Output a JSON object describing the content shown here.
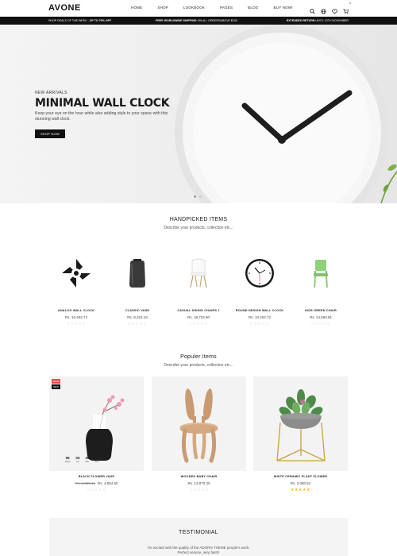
{
  "header": {
    "logo": "AVONE",
    "nav": [
      "HOME",
      "SHOP",
      "LOOKBOOK",
      "PAGES",
      "BLOG",
      "BUY NOW!"
    ],
    "cart_count": "0",
    "icons": [
      "search-icon",
      "globe-icon",
      "heart-icon",
      "cart-icon"
    ]
  },
  "promo": {
    "left_prefix": "SHOP DEALS OF THE WEEK - ",
    "left_bold": "UP TO 70% OFF",
    "center_bold": "FREE WORLDWIDE SHIPPING",
    "center_rest": " ON ALL ORDERSABOVE $100",
    "right_bold": "EXTENDED RETURN",
    "right_rest": " UNTIL 10TH NOVEMBER"
  },
  "hero": {
    "subtitle": "NEW ARRIVALS",
    "title": "MINIMAL WALL CLOCK",
    "description": "Keep your eye on the hour while also adding style to your space with this stunning wall clock.",
    "button": "SHOP NOW"
  },
  "handpicked": {
    "title": "HANDPICKED ITEMS",
    "subtitle": "Describe your products, collection etc...",
    "items": [
      {
        "name": "ANALOG WALL CLOCK",
        "price": "Rs. 10,402.72",
        "stars": "☆☆☆☆☆"
      },
      {
        "name": "CLASSIC VASE",
        "price": "Rs. 8,322.18",
        "stars": "☆☆☆☆☆"
      },
      {
        "name": "CASUAL DINING CHAIRS 1",
        "price": "Rs. 18,724.90",
        "stars": "☆☆☆☆☆"
      },
      {
        "name": "ROUND DESIGN WALL CLOCK",
        "price": "Rs. 10,402.72",
        "stars": "☆☆☆☆☆"
      },
      {
        "name": "KIDS GREEN CHAIR",
        "price": "Rs. 14,563.81",
        "stars": "☆☆☆☆☆"
      }
    ]
  },
  "popular": {
    "title": "Populer Items",
    "subtitle": "Describe your products, collection etc...",
    "items": [
      {
        "name": "BLACK FLOWER VASE",
        "old_price": "Rs. 6,335.15",
        "price": "Rs. 4,854.50",
        "stars": "☆☆☆☆☆",
        "rating": 0,
        "badge_sale": "SALE",
        "badge_new": "NEW"
      },
      {
        "name": "WOODEN BABY CHAIR",
        "price": "Rs. 13,870.30",
        "stars": "☆☆☆☆☆",
        "rating": 0
      },
      {
        "name": "WHITE CERAMIC PLANT FLOWER",
        "price": "Rs. 2,080.54",
        "stars": "★★★★★",
        "rating": 5
      }
    ],
    "countdown": [
      {
        "value": "06",
        "label": "Days"
      },
      {
        "value": "03",
        "label": "Hr"
      },
      {
        "value": "45",
        "label": "Min"
      },
      {
        "value": "29",
        "label": "Sec"
      }
    ]
  },
  "testimonial": {
    "title": "TESTIMONIAL",
    "text": "I'm excited with the quality of the ADORN THEME people's work.",
    "text2": "Perfect service, very fast!!!"
  },
  "colors": {
    "dark": "#111111",
    "sale": "#e8554f",
    "star": "#f2b705",
    "chair_green": "#8fd07a"
  }
}
